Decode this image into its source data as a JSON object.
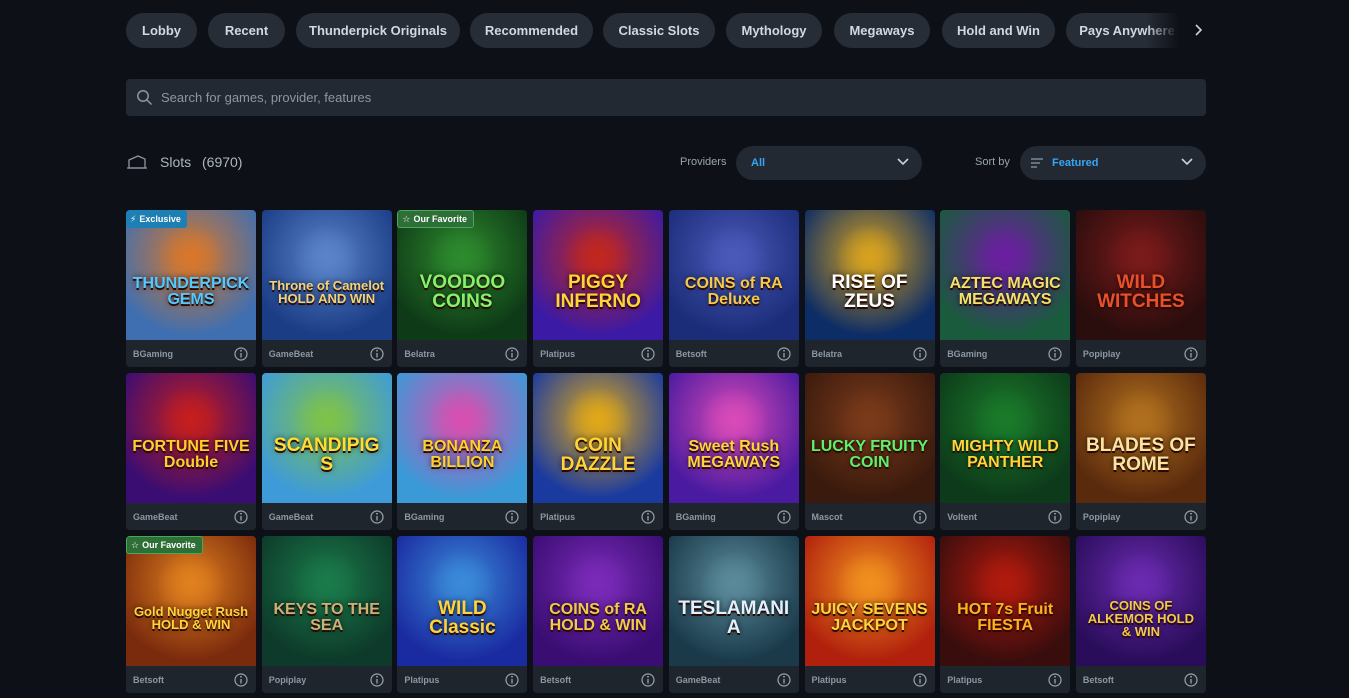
{
  "categories": [
    {
      "label": "Lobby"
    },
    {
      "label": "Recent"
    },
    {
      "label": "Thunderpick Originals"
    },
    {
      "label": "Recommended"
    },
    {
      "label": "Classic Slots"
    },
    {
      "label": "Mythology"
    },
    {
      "label": "Megaways"
    },
    {
      "label": "Hold and Win"
    },
    {
      "label": "Pays Anywhere"
    }
  ],
  "search": {
    "placeholder": "Search for games, provider, features"
  },
  "section": {
    "title": "Slots",
    "count": "(6970)"
  },
  "filters": {
    "providers_label": "Providers",
    "providers_value": "All",
    "sort_label": "Sort by",
    "sort_value": "Featured"
  },
  "colors": {
    "accent": "#35a6f4",
    "chip_bg": "#272d36",
    "page_bg": "#0d1117",
    "exclusive_badge": "#1d7fb3",
    "favorite_badge": "#2e6e37"
  },
  "games": [
    {
      "title": "THUNDERPICK GEMS",
      "provider": "BGaming",
      "badge": "Exclusive",
      "bg": [
        "#3f6fb0",
        "#d9772a"
      ],
      "fg": "#53c9ff"
    },
    {
      "title": "Throne of Camelot HOLD AND WIN",
      "provider": "GameBeat",
      "badge": "",
      "bg": [
        "#1b3d86",
        "#5a83c9"
      ],
      "fg": "#f2d27a"
    },
    {
      "title": "VOODOO COINS",
      "provider": "Belatra",
      "badge": "Our Favorite",
      "bg": [
        "#0e3a17",
        "#2d8a2d"
      ],
      "fg": "#88f06a"
    },
    {
      "title": "PIGGY INFERNO",
      "provider": "Platipus",
      "badge": "",
      "bg": [
        "#3b1aa5",
        "#c2271e"
      ],
      "fg": "#ffd43b"
    },
    {
      "title": "COINS of RA Deluxe",
      "provider": "Betsoft",
      "badge": "",
      "bg": [
        "#1b2d79",
        "#4a59b9"
      ],
      "fg": "#f4c94a"
    },
    {
      "title": "RISE OF ZEUS",
      "provider": "Belatra",
      "badge": "",
      "bg": [
        "#0d2d66",
        "#d7a21e"
      ],
      "fg": "#ffffff"
    },
    {
      "title": "AZTEC MAGIC MEGAWAYS",
      "provider": "BGaming",
      "badge": "",
      "bg": [
        "#1a5a3d",
        "#6a1ea0"
      ],
      "fg": "#f4e06a"
    },
    {
      "title": "WILD WITCHES",
      "provider": "Popiplay",
      "badge": "",
      "bg": [
        "#2a0d0d",
        "#7a1a1a"
      ],
      "fg": "#e8502a"
    },
    {
      "title": "FORTUNE FIVE Double",
      "provider": "GameBeat",
      "badge": "",
      "bg": [
        "#3a0d73",
        "#c51e1e"
      ],
      "fg": "#ffcf2e"
    },
    {
      "title": "SCANDIPIGS",
      "provider": "GameBeat",
      "badge": "",
      "bg": [
        "#3e9bd8",
        "#7ec24a"
      ],
      "fg": "#ffdd33"
    },
    {
      "title": "BONANZA BILLION",
      "provider": "BGaming",
      "badge": "",
      "bg": [
        "#3a9ad8",
        "#d74fb0"
      ],
      "fg": "#ffcf2e"
    },
    {
      "title": "COIN DAZZLE",
      "provider": "Platipus",
      "badge": "",
      "bg": [
        "#1a3aa0",
        "#e0a818"
      ],
      "fg": "#ffd43b"
    },
    {
      "title": "Sweet Rush MEGAWAYS",
      "provider": "BGaming",
      "badge": "",
      "bg": [
        "#4a1aa0",
        "#d84ab8"
      ],
      "fg": "#ffd43b"
    },
    {
      "title": "LUCKY FRUITY COIN",
      "provider": "Mascot",
      "badge": "",
      "bg": [
        "#3a1a0d",
        "#7a3a1a"
      ],
      "fg": "#5ef06a"
    },
    {
      "title": "MIGHTY WILD PANTHER",
      "provider": "Voltent",
      "badge": "",
      "bg": [
        "#0d3a1a",
        "#1a7a2a"
      ],
      "fg": "#ffd43b"
    },
    {
      "title": "BLADES OF ROME",
      "provider": "Popiplay",
      "badge": "",
      "bg": [
        "#5a2a0d",
        "#b0701e"
      ],
      "fg": "#fbe3a2"
    },
    {
      "title": "Gold Nugget Rush HOLD & WIN",
      "provider": "Betsoft",
      "badge": "Our Favorite",
      "bg": [
        "#7a2a0d",
        "#e0801e"
      ],
      "fg": "#ffd43b"
    },
    {
      "title": "KEYS TO THE SEA",
      "provider": "Popiplay",
      "badge": "",
      "bg": [
        "#0d3a2a",
        "#1a7a4a"
      ],
      "fg": "#c9b27a"
    },
    {
      "title": "WILD Classic",
      "provider": "Platipus",
      "badge": "",
      "bg": [
        "#1a2aa0",
        "#3a8ad8"
      ],
      "fg": "#ffd43b"
    },
    {
      "title": "COINS of RA HOLD & WIN",
      "provider": "Betsoft",
      "badge": "",
      "bg": [
        "#3a0d73",
        "#7a2ab8"
      ],
      "fg": "#f4c94a"
    },
    {
      "title": "TESLAMANIA",
      "provider": "GameBeat",
      "badge": "",
      "bg": [
        "#1a3a4a",
        "#5a8a9a"
      ],
      "fg": "#e0f0ff"
    },
    {
      "title": "JUICY SEVENS JACKPOT",
      "provider": "Platipus",
      "badge": "",
      "bg": [
        "#b0200d",
        "#f0901e"
      ],
      "fg": "#ffd43b"
    },
    {
      "title": "HOT 7s Fruit FIESTA",
      "provider": "Platipus",
      "badge": "",
      "bg": [
        "#3a0d0d",
        "#b01a0d"
      ],
      "fg": "#ffb21e"
    },
    {
      "title": "COINS OF ALKEMOR HOLD & WIN",
      "provider": "Betsoft",
      "badge": "",
      "bg": [
        "#2a0d5a",
        "#6a2ab0"
      ],
      "fg": "#f4c94a"
    }
  ]
}
